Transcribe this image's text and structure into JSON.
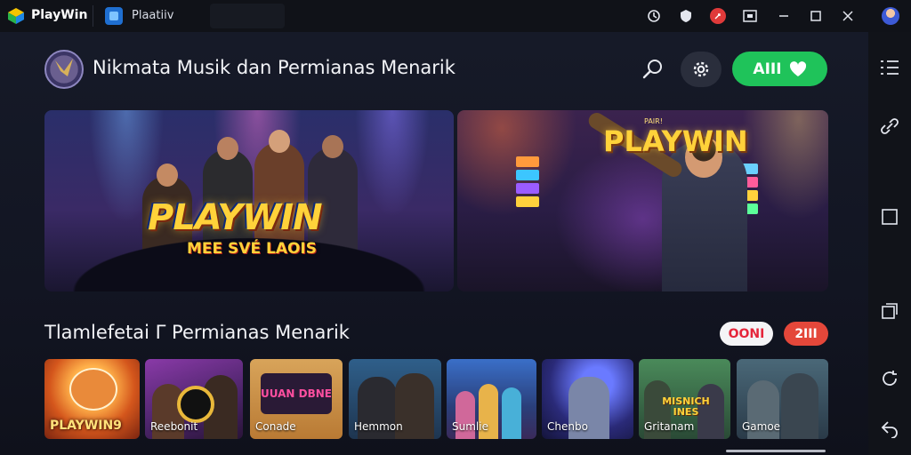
{
  "titlebar": {
    "app_name": "PlayWin",
    "tab_title": "Plaatiiv",
    "controls": [
      "timer-icon",
      "shield-icon",
      "record-icon",
      "screenshot-icon",
      "minimize-icon",
      "maximize-icon",
      "close-icon"
    ]
  },
  "header": {
    "title": "Nikmata Musik dan Permianas Menarik",
    "cta_label": "AIII"
  },
  "banners": [
    {
      "logo": "PLAYWIN",
      "subtitle": "MEE SVÉ LAOIS"
    },
    {
      "tag": "PAIR!",
      "logo": "PLAYWIN"
    }
  ],
  "section": {
    "title": "Tlamlefetai Γ Permianas Menarik",
    "pill_1": "OONI",
    "pill_2": "2III"
  },
  "cards": [
    {
      "label": "PLAYWIN9"
    },
    {
      "label": "Reebonit",
      "badge": ""
    },
    {
      "label": "Conade",
      "badge": "UUAN DBNE"
    },
    {
      "label": "Hemmon"
    },
    {
      "label": "Sumlie"
    },
    {
      "label": "Chenbo"
    },
    {
      "label": "Gritanam",
      "badge": "MISNICH INES"
    },
    {
      "label": "Gamoe"
    }
  ],
  "rail": [
    "menu-icon",
    "link-icon",
    "window-icon",
    "layers-icon",
    "rotate-icon",
    "back-icon"
  ],
  "colors": {
    "accent_green": "#1fc35a",
    "accent_red": "#e4473a",
    "logo_yellow": "#ffd23a",
    "bg": "#121522"
  }
}
